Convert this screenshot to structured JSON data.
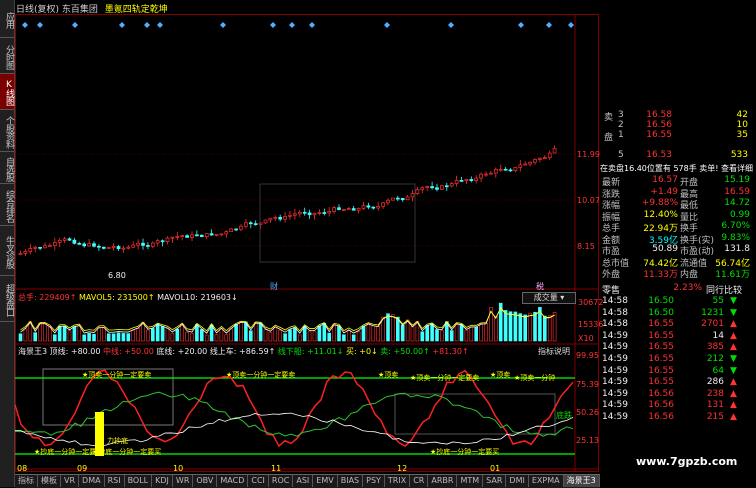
{
  "side_tabs": [
    {
      "label": "应用",
      "active": false
    },
    {
      "label": "分时图",
      "active": false
    },
    {
      "label": "K线图",
      "active": true
    },
    {
      "label": "个股资料",
      "active": false
    },
    {
      "label": "自选股",
      "active": false
    },
    {
      "label": "综合排名",
      "active": false
    },
    {
      "label": "牛叉诊股",
      "active": false
    },
    {
      "label": "超级盘口",
      "active": false
    }
  ],
  "header": {
    "title": "日线(复权) 东百集团",
    "indicator": "墨氪四轨定乾坤"
  },
  "price_axis": [
    "11.99",
    "10.07",
    "8.15"
  ],
  "price_low_label": "6.80",
  "event_marks": [
    "财",
    "税"
  ],
  "volume": {
    "total_label": "总手: 229409↑",
    "mavol5": "MAVOL5: 231500↑",
    "mavol10": "MAVOL10: 219603↓",
    "button": "成交量",
    "axis": [
      "30672",
      "15336",
      "X10"
    ]
  },
  "indicator": {
    "name": "海景王3 顶线: +80.00",
    "mid": "中线: +50.00",
    "bottom": "底线: +20.00",
    "up": "线上车: +86.59↑",
    "down": "线下船: +11.01↓",
    "buy": "买: +0↓",
    "sell": "卖: +50.00↑",
    "extra": "+81.30↑",
    "explain": "指标说明",
    "axis": [
      "99.95",
      "75.39",
      "50.26",
      "25.13"
    ],
    "top_labels": [
      "★顶卖一分钟一定要卖",
      "★顶卖一分钟一定要卖",
      "★顶卖",
      "★顶卖一分钟一定要卖",
      "★顶卖",
      "★顶卖一分钟"
    ],
    "bottom_labels": [
      "★抄底一分钟一定要买",
      "★抄底一分钟一定要买",
      "★抄底一分钟一定要买"
    ],
    "sell_marker": "底跌",
    "pad_marker": "力抄底"
  },
  "date_axis": [
    "08",
    "09",
    "10",
    "11",
    "12",
    "01"
  ],
  "bottom_tabs": [
    "指标",
    "模板",
    "VR",
    "DMA",
    "RSI",
    "BOLL",
    "KDJ",
    "WR",
    "OBV",
    "MACD",
    "CCI",
    "ROC",
    "ASI",
    "EMV",
    "BIAS",
    "PSY",
    "TRIX",
    "CR",
    "ARBR",
    "MTM",
    "SAR",
    "DMI",
    "EXPMA"
  ],
  "bottom_active": "海景王3",
  "order_book": {
    "sell": [
      {
        "side": "卖",
        "level": "3",
        "price": "16.58",
        "vol": "42"
      },
      {
        "side": "",
        "level": "2",
        "price": "16.56",
        "vol": "10"
      },
      {
        "side": "盘",
        "level": "1",
        "price": "16.55",
        "vol": "35"
      },
      {
        "side": "",
        "level": "",
        "price": "",
        "vol": ""
      },
      {
        "side": "",
        "level": "5",
        "price": "16.53",
        "vol": "533"
      }
    ],
    "summary_line": "在卖盘16.40位置有  578手  卖单! 查看详细"
  },
  "quote": [
    {
      "l1": "最新",
      "v1": "16.57",
      "c1": "red",
      "l2": "开盘",
      "v2": "15.19",
      "c2": "green"
    },
    {
      "l1": "涨跌",
      "v1": "+1.49",
      "c1": "red",
      "l2": "最高",
      "v2": "16.59",
      "c2": "red"
    },
    {
      "l1": "涨幅",
      "v1": "+9.88%",
      "c1": "red",
      "l2": "最低",
      "v2": "14.72",
      "c2": "green"
    },
    {
      "l1": "振幅",
      "v1": "12.40%",
      "c1": "yellow",
      "l2": "量比",
      "v2": "0.99",
      "c2": "green"
    },
    {
      "l1": "总手",
      "v1": "22.94万",
      "c1": "yellow",
      "l2": "换手",
      "v2": "6.70%",
      "c2": "green"
    },
    {
      "l1": "金额",
      "v1": "3.59亿",
      "c1": "cyan",
      "l2": "换手(实)",
      "v2": "9.83%",
      "c2": "green"
    },
    {
      "l1": "市盈",
      "v1": "50.89",
      "c1": "white",
      "l2": "市盈(动)",
      "v2": "131.8",
      "c2": "white"
    },
    {
      "l1": "总市值",
      "v1": "74.42亿",
      "c1": "yellow",
      "l2": "流通值",
      "v2": "56.74亿",
      "c2": "yellow"
    },
    {
      "l1": "外盘",
      "v1": "11.33万",
      "c1": "red",
      "l2": "内盘",
      "v2": "11.61万",
      "c2": "green"
    }
  ],
  "ranking": {
    "label": "零售",
    "pct": "2.23%",
    "compare": "同行比较"
  },
  "ticks": [
    {
      "time": "14:58",
      "price": "16.50",
      "vol": "55",
      "dir": "down",
      "pc": "green",
      "vc": "green"
    },
    {
      "time": "14:58",
      "price": "16.50",
      "vol": "1231",
      "dir": "down",
      "pc": "green",
      "vc": "green"
    },
    {
      "time": "14:58",
      "price": "16.55",
      "vol": "2701",
      "dir": "up",
      "pc": "red",
      "vc": "red"
    },
    {
      "time": "14:59",
      "price": "16.55",
      "vol": "14",
      "dir": "up",
      "pc": "red",
      "vc": "white"
    },
    {
      "time": "14:59",
      "price": "16.55",
      "vol": "385",
      "dir": "up",
      "pc": "red",
      "vc": "red"
    },
    {
      "time": "14:59",
      "price": "16.55",
      "vol": "212",
      "dir": "down",
      "pc": "red",
      "vc": "green"
    },
    {
      "time": "14:59",
      "price": "16.55",
      "vol": "64",
      "dir": "down",
      "pc": "red",
      "vc": "green"
    },
    {
      "time": "14:59",
      "price": "16.55",
      "vol": "286",
      "dir": "up",
      "pc": "red",
      "vc": "white"
    },
    {
      "time": "14:59",
      "price": "16.56",
      "vol": "238",
      "dir": "up",
      "pc": "red",
      "vc": "red"
    },
    {
      "time": "14:59",
      "price": "16.56",
      "vol": "131",
      "dir": "up",
      "pc": "red",
      "vc": "red"
    },
    {
      "time": "14:59",
      "price": "16.56",
      "vol": "215",
      "dir": "up",
      "pc": "red",
      "vc": "red"
    }
  ],
  "watermark": "www.7gpzb.com"
}
